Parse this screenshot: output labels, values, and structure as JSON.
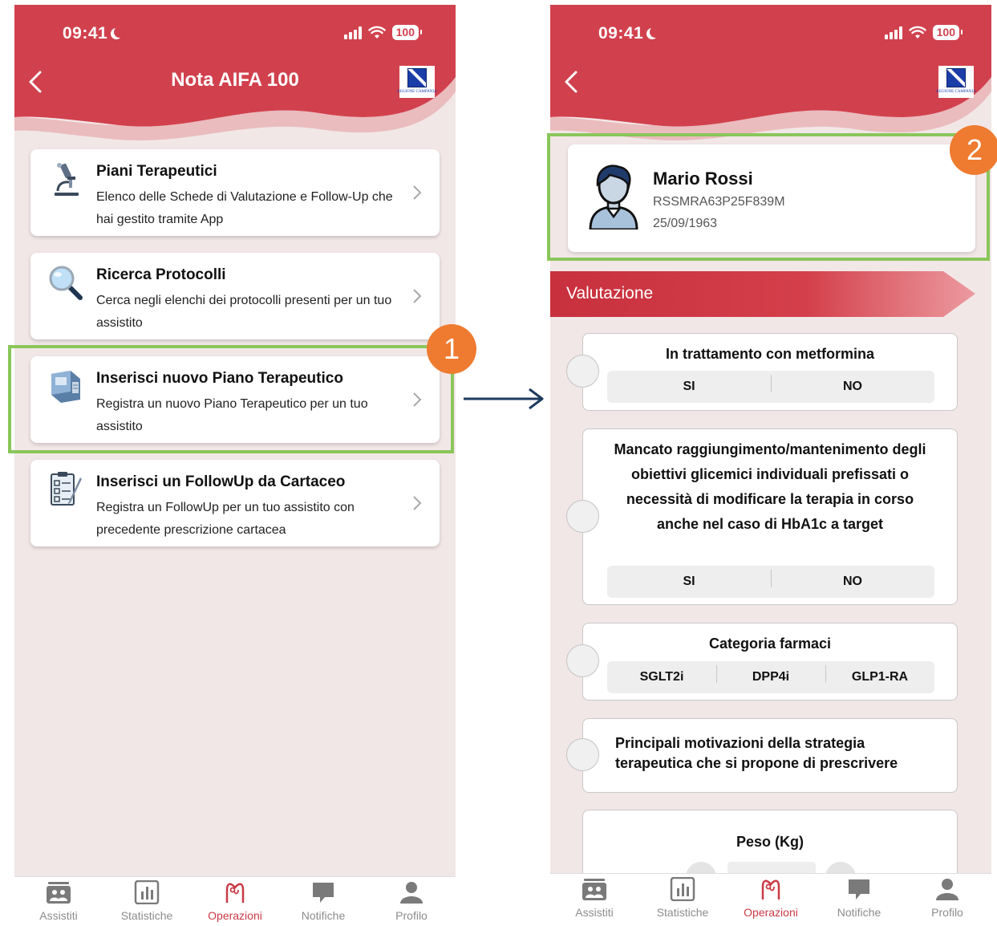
{
  "status_bar": {
    "time": "09:41",
    "battery": "100"
  },
  "left_screen": {
    "nav_title": "Nota AIFA 100",
    "menu": [
      {
        "title": "Piani Terapeutici",
        "desc": "Elenco delle Schede di Valutazione e Follow-Up che hai gestito tramite App",
        "icon": "microscope-icon"
      },
      {
        "title": "Ricerca Protocolli",
        "desc": "Cerca negli elenchi dei protocolli presenti per un tuo assistito",
        "icon": "magnifier-icon"
      },
      {
        "title": "Inserisci nuovo Piano Terapeutico",
        "desc": "Registra un nuovo Piano Terapeutico per un tuo assistito",
        "icon": "card-reader-icon"
      },
      {
        "title": "Inserisci un FollowUp da Cartaceo",
        "desc": "Registra un FollowUp per un tuo assistito con precedente prescrizione cartacea",
        "icon": "checklist-icon"
      }
    ]
  },
  "right_screen": {
    "patient": {
      "name": "Mario Rossi",
      "fiscal_code": "RSSMRA63P25F839M",
      "birth_date": "25/09/1963"
    },
    "section_title": "Valutazione",
    "questions": [
      {
        "title": "In trattamento con metformina",
        "options": [
          "SI",
          "NO"
        ]
      },
      {
        "title": "Mancato raggiungimento/mantenimento degli obiettivi glicemici individuali prefissati o necessità di modificare la terapia in corso anche nel caso di HbA1c a target",
        "options": [
          "SI",
          "NO"
        ]
      },
      {
        "title": "Categoria farmaci",
        "options": [
          "SGLT2i",
          "DPP4i",
          "GLP1-RA"
        ]
      },
      {
        "title": "Principali motivazioni della strategia terapeutica che si propone di prescrivere"
      },
      {
        "title": "Peso (Kg)"
      }
    ]
  },
  "tabbar": {
    "tabs": [
      {
        "label": "Assistiti",
        "icon": "patients-icon"
      },
      {
        "label": "Statistiche",
        "icon": "chart-icon"
      },
      {
        "label": "Operazioni",
        "icon": "stethoscope-icon",
        "active": true
      },
      {
        "label": "Notifiche",
        "icon": "chat-icon"
      },
      {
        "label": "Profilo",
        "icon": "user-icon"
      }
    ]
  },
  "annotations": {
    "badge_1": "1",
    "badge_2": "2"
  },
  "colors": {
    "brand_red": "#d1414d",
    "active_tab": "#c93a45",
    "highlight_green": "#8ac65a",
    "badge_orange": "#ee7b30",
    "background": "#f2e7e7"
  }
}
